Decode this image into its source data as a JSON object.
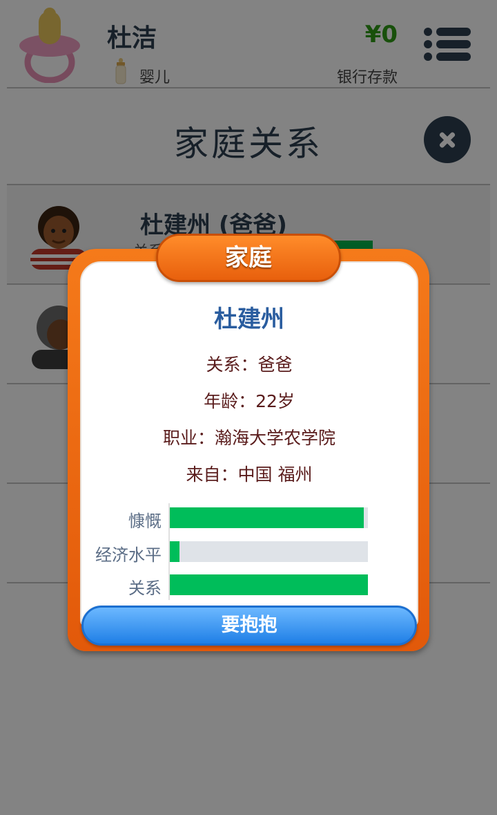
{
  "header": {
    "player_name": "杜洁",
    "life_stage": "婴儿",
    "money": "¥0",
    "bank_label": "银行存款"
  },
  "section": {
    "title": "家庭关系"
  },
  "family_list": [
    {
      "name": "杜建州 (爸爸)",
      "sub": "关系"
    }
  ],
  "modal": {
    "tab_label": "家庭",
    "person_name": "杜建州",
    "relation_line": "关系：爸爸",
    "age_line": "年龄：22岁",
    "job_line": "职业：瀚海大学农学院",
    "from_line": "来自：中国 福州",
    "stats": [
      {
        "label": "慷慨",
        "value": 0.98,
        "color": "#00bd5a"
      },
      {
        "label": "经济水平",
        "value": 0.05,
        "color": "#00bd5a"
      },
      {
        "label": "关系",
        "value": 1.0,
        "color": "#00bd5a"
      }
    ],
    "hug_button": "要抱抱"
  },
  "colors": {
    "accent_orange": "#f57a1a",
    "title_blue": "#2a5d9f",
    "stat_green": "#00bd5a",
    "money_green": "#2e9a16",
    "button_blue": "#1f7fe6"
  }
}
